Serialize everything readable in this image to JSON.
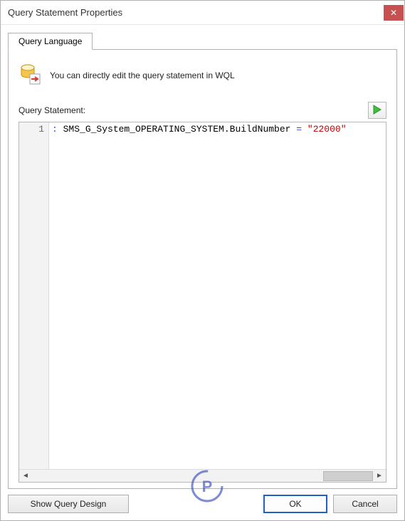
{
  "window": {
    "title": "Query Statement Properties",
    "close_glyph": "✕"
  },
  "tabs": {
    "active": "Query Language"
  },
  "info": {
    "text": "You can directly edit the query statement in WQL"
  },
  "query": {
    "label": "Query Statement:",
    "line_number": "1",
    "code_prefix": " SMS_G_System_OPERATING_SYSTEM.BuildNumber ",
    "code_operator": "=",
    "code_string": "\"22000\""
  },
  "buttons": {
    "show_design": "Show Query Design",
    "ok": "OK",
    "cancel": "Cancel"
  },
  "icons": {
    "db_export": "db-export-icon",
    "run": "run-icon"
  }
}
